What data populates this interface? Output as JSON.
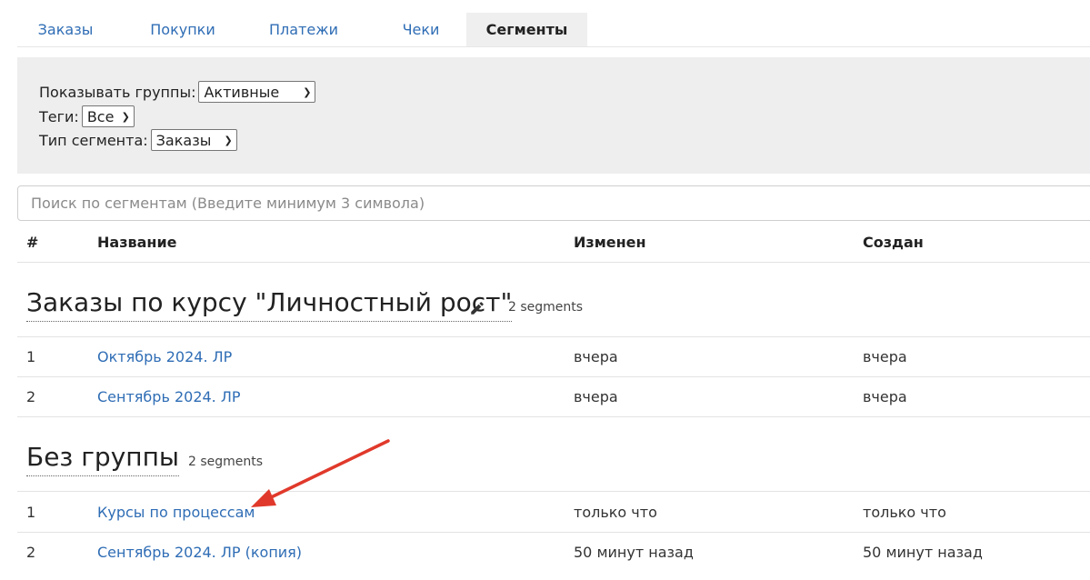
{
  "tabs": [
    {
      "label": "Заказы"
    },
    {
      "label": "Покупки"
    },
    {
      "label": "Платежи"
    },
    {
      "label": "Чеки"
    },
    {
      "label": "Сегменты",
      "active": true
    }
  ],
  "filters": {
    "groups_label": "Показывать группы:",
    "groups_value": "Активные",
    "tags_label": "Теги:",
    "tags_value": "Все",
    "type_label": "Тип сегмента:",
    "type_value": "Заказы"
  },
  "search": {
    "placeholder": "Поиск по сегментам (Введите минимум 3 символа)"
  },
  "table": {
    "headers": {
      "num": "#",
      "name": "Название",
      "modified": "Изменен",
      "created": "Создан"
    },
    "groups": [
      {
        "title": "Заказы по курсу \"Личностный рост\"",
        "count": "2 segments",
        "rows": [
          {
            "num": "1",
            "name": "Октябрь 2024. ЛР",
            "modified": "вчера",
            "created": "вчера"
          },
          {
            "num": "2",
            "name": "Сентябрь 2024. ЛР",
            "modified": "вчера",
            "created": "вчера"
          }
        ]
      },
      {
        "title": "Без группы",
        "count": "2 segments",
        "rows": [
          {
            "num": "1",
            "name": "Курсы по процессам",
            "modified": "только что",
            "created": "только что"
          },
          {
            "num": "2",
            "name": "Сентябрь 2024. ЛР (копия)",
            "modified": "50 минут назад",
            "created": "50 минут назад"
          }
        ]
      }
    ]
  },
  "colors": {
    "link": "#2f6db5",
    "arrow": "#e0392b",
    "filter_bg": "#eeeeee"
  },
  "icons": {
    "edit": "pencil-icon",
    "dropdown": "chevron-down-icon"
  }
}
